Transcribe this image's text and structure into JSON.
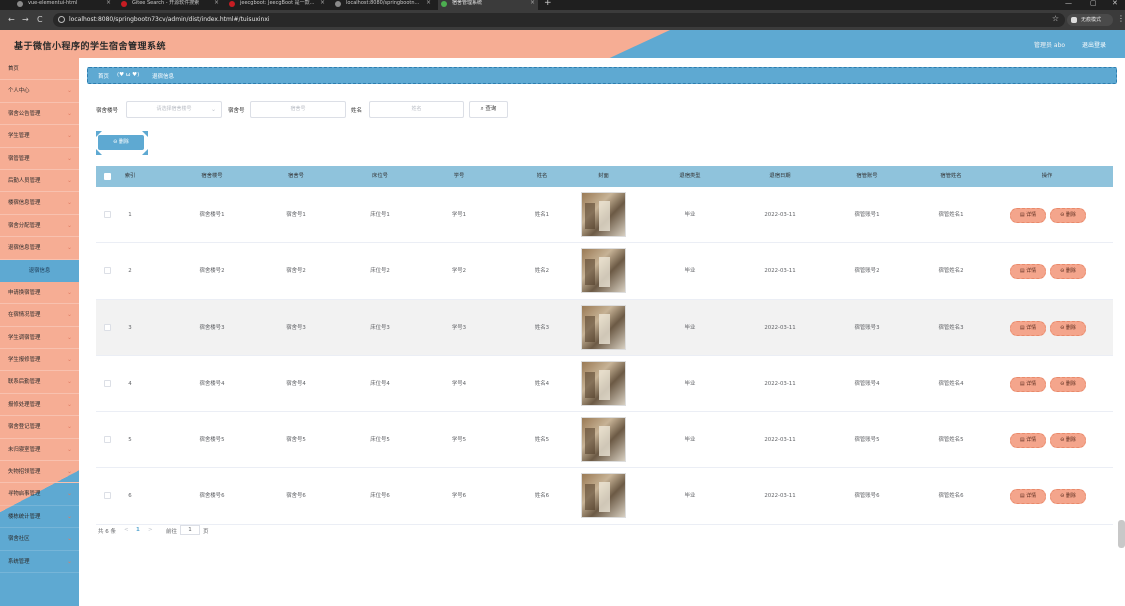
{
  "browser": {
    "tabs": [
      {
        "label": "vue-elementui-html",
        "color": "#8a8a8a"
      },
      {
        "label": "Gitee Search - 开源软件搜索",
        "color": "#c71d23"
      },
      {
        "label": "jeecgboot: JeecgBoot 是一款...",
        "color": "#c71d23"
      },
      {
        "label": "localhost:8080/springbootn...",
        "color": "#8a8a8a"
      },
      {
        "label": "宿舍管理系统",
        "color": "#4caf50"
      }
    ],
    "url": "localhost:8080/springbootn73cv/admin/dist/index.html#/tuisuxinxi",
    "incognito_label": "无痕模式",
    "new_tab": "+",
    "back": "←",
    "forward": "→",
    "reload": "C",
    "star": "☆",
    "menu": "⋮",
    "minimize": "—",
    "maximize": "▢",
    "close": "✕"
  },
  "header": {
    "title": "基于微信小程序的学生宿舍管理系统",
    "user": "管理员 abo",
    "logout": "退出登录"
  },
  "sidebar": {
    "items": [
      {
        "label": "首页",
        "chevron": false
      },
      {
        "label": "个人中心",
        "chevron": true
      },
      {
        "label": "宿舍公告管理",
        "chevron": true
      },
      {
        "label": "学生管理",
        "chevron": true
      },
      {
        "label": "宿管管理",
        "chevron": true
      },
      {
        "label": "后勤人员管理",
        "chevron": true
      },
      {
        "label": "楼宿信息管理",
        "chevron": true
      },
      {
        "label": "宿舍分配管理",
        "chevron": true
      },
      {
        "label": "退宿信息管理",
        "chevron": true
      },
      {
        "label": "退宿信息",
        "chevron": false,
        "sub": true
      },
      {
        "label": "申请换宿管理",
        "chevron": true
      },
      {
        "label": "在宿情况管理",
        "chevron": true
      },
      {
        "label": "学生调宿管理",
        "chevron": true
      },
      {
        "label": "学生报修管理",
        "chevron": true
      },
      {
        "label": "联系后勤管理",
        "chevron": true
      },
      {
        "label": "报修处理管理",
        "chevron": true
      },
      {
        "label": "宿舍登记管理",
        "chevron": true
      },
      {
        "label": "未归寝室管理",
        "chevron": true
      },
      {
        "label": "失物招领管理",
        "chevron": true
      },
      {
        "label": "寻物启事管理",
        "chevron": true
      },
      {
        "label": "楼栋统计管理",
        "chevron": true
      },
      {
        "label": "宿舍社区",
        "chevron": true
      },
      {
        "label": "系统管理",
        "chevron": true
      }
    ]
  },
  "breadcrumb": {
    "home": "首页",
    "separator": "(♥ ω ♥)",
    "current": "退宿信息"
  },
  "filters": {
    "building_label": "宿舍楼号",
    "building_placeholder": "请选择宿舍楼号",
    "room_label": "宿舍号",
    "room_placeholder": "宿舍号",
    "name_label": "姓名",
    "name_placeholder": "姓名",
    "query_button": "查询",
    "delete_button": "删除"
  },
  "table": {
    "columns": [
      "索引",
      "宿舍楼号",
      "宿舍号",
      "床位号",
      "学号",
      "姓名",
      "封面",
      "退宿类型",
      "退宿日期",
      "宿管账号",
      "宿管姓名",
      "操作"
    ],
    "rows": [
      {
        "index": "1",
        "building": "宿舍楼号1",
        "room": "宿舍号1",
        "bed": "床位号1",
        "sid": "学号1",
        "name": "姓名1",
        "type": "毕业",
        "date": "2022-03-11",
        "account": "宿管账号1",
        "manager": "宿管姓名1"
      },
      {
        "index": "2",
        "building": "宿舍楼号2",
        "room": "宿舍号2",
        "bed": "床位号2",
        "sid": "学号2",
        "name": "姓名2",
        "type": "毕业",
        "date": "2022-03-11",
        "account": "宿管账号2",
        "manager": "宿管姓名2"
      },
      {
        "index": "3",
        "building": "宿舍楼号3",
        "room": "宿舍号3",
        "bed": "床位号3",
        "sid": "学号3",
        "name": "姓名3",
        "type": "毕业",
        "date": "2022-03-11",
        "account": "宿管账号3",
        "manager": "宿管姓名3"
      },
      {
        "index": "4",
        "building": "宿舍楼号4",
        "room": "宿舍号4",
        "bed": "床位号4",
        "sid": "学号4",
        "name": "姓名4",
        "type": "毕业",
        "date": "2022-03-11",
        "account": "宿管账号4",
        "manager": "宿管姓名4"
      },
      {
        "index": "5",
        "building": "宿舍楼号5",
        "room": "宿舍号5",
        "bed": "床位号5",
        "sid": "学号5",
        "name": "姓名5",
        "type": "毕业",
        "date": "2022-03-11",
        "account": "宿管账号5",
        "manager": "宿管姓名5"
      },
      {
        "index": "6",
        "building": "宿舍楼号6",
        "room": "宿舍号6",
        "bed": "床位号6",
        "sid": "学号6",
        "name": "姓名6",
        "type": "毕业",
        "date": "2022-03-11",
        "account": "宿管账号6",
        "manager": "宿管姓名6"
      }
    ],
    "detail_label": "详情",
    "delete_label": "删除",
    "highlighted_row": 3
  },
  "pagination": {
    "total": "共 6 条",
    "prev": "<",
    "current_page": "1",
    "next": ">",
    "goto_label": "前往",
    "goto_value": "1",
    "page_suffix": "页"
  },
  "colors": {
    "peach": "#f6ad94",
    "blue": "#5ea9d2",
    "header_blue": "#8fc3dc",
    "action": "#f4a58c"
  }
}
